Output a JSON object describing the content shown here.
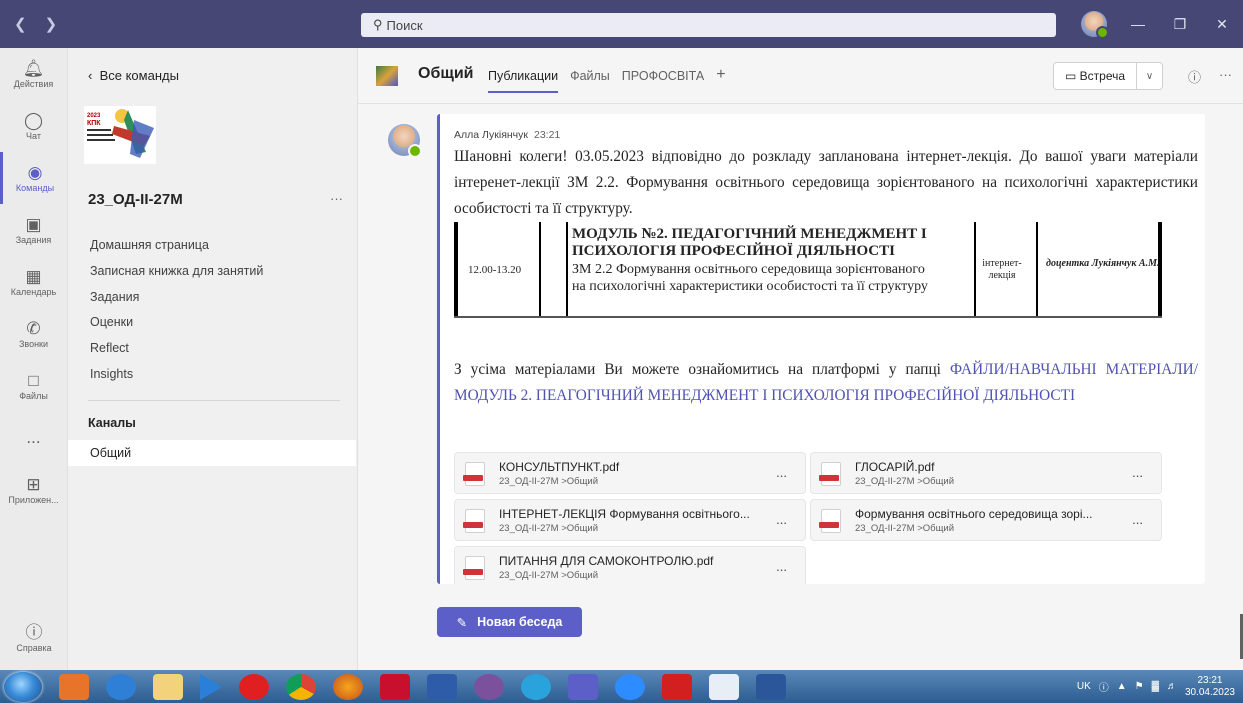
{
  "titlebar": {
    "search_placeholder": "Поиск",
    "more": "...",
    "minimize": "—",
    "maximize": "❐",
    "close": "✕"
  },
  "rail": {
    "items": [
      {
        "label": "Действия",
        "icon": "🔔"
      },
      {
        "label": "Чат",
        "icon": "💬"
      },
      {
        "label": "Команды",
        "icon": "👥"
      },
      {
        "label": "Задания",
        "icon": "🎒"
      },
      {
        "label": "Календарь",
        "icon": "📅"
      },
      {
        "label": "Звонки",
        "icon": "📞"
      },
      {
        "label": "Файлы",
        "icon": "📄"
      },
      {
        "label": "...",
        "icon": ""
      },
      {
        "label": "Приложен...",
        "icon": "⊞"
      }
    ],
    "help": "Справка"
  },
  "sidebar": {
    "back": "Все команды",
    "team_name": "23_ОД-ІІ-27М",
    "nav": [
      "Домашняя страница",
      "Записная книжка для занятий",
      "Задания",
      "Оценки",
      "Reflect",
      "Insights"
    ],
    "channels_heading": "Каналы",
    "channel": "Общий"
  },
  "header": {
    "channel_title": "Общий",
    "tabs": [
      "Публикации",
      "Файлы",
      "ПРОФОСВІТА"
    ],
    "add_tab": "+",
    "meet_label": "Встреча"
  },
  "post": {
    "author": "Алла Лукіянчук",
    "time": "23:21",
    "text1": "Шановні колеги! 03.05.2023 відповідно до розкладу запланована інтернет-лекція. До вашої уваги матеріали інтеренет-лекції ЗМ 2.2. Формування освітнього середовища зорієнтованого на психологічні характеристики особистості та її структуру.",
    "table": {
      "time": "12.00-13.20",
      "title": "МОДУЛЬ №2. ПЕДАГОГІЧНИЙ МЕНЕДЖМЕНТ І ПСИХОЛОГІЯ ПРОФЕСІЙНОЇ ДІЯЛЬНОСТІ",
      "desc": "ЗМ 2.2 Формування освітнього середовища зорієнтованого на психологічні характеристики особистості та її структуру",
      "kind": "інтернет-лекція",
      "teacher": "доцентка Лукіянчук А.М."
    },
    "text2_prefix": "З усіма матеріалами Ви можете ознайомитись на платформі у папці ",
    "text2_link": "ФАЙЛИ/НАВЧАЛЬНІ МАТЕРІАЛИ/МОДУЛЬ 2. ПЕАГОГІЧНИЙ МЕНЕДЖМЕНТ І ПСИХОЛОГІЯ ПРОФЕСІЙНОЇ ДІЯЛЬНОСТІ",
    "files": [
      {
        "name": "КОНСУЛЬТПУНКТ.pdf",
        "path": "23_ОД-ІІ-27М >Общий"
      },
      {
        "name": "ГЛОСАРІЙ.pdf",
        "path": "23_ОД-ІІ-27М >Общий"
      },
      {
        "name": "ІНТЕРНЕТ-ЛЕКЦІЯ Формування освітнього...",
        "path": "23_ОД-ІІ-27М >Общий"
      },
      {
        "name": "Формування освітнього середовища зорі...",
        "path": "23_ОД-ІІ-27М >Общий"
      },
      {
        "name": "ПИТАННЯ ДЛЯ САМОКОНТРОЛЮ.pdf",
        "path": "23_ОД-ІІ-27М >Общий"
      }
    ],
    "file_more": "..."
  },
  "new_conversation": "Новая беседа",
  "taskbar": {
    "lang": "UK",
    "time": "23:21",
    "date": "30.04.2023"
  }
}
